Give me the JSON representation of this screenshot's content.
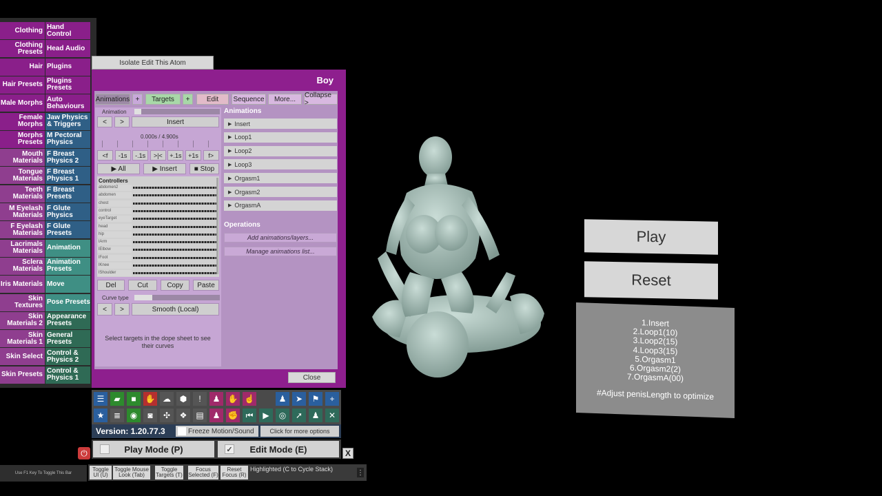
{
  "left_menu": {
    "rows": [
      {
        "left": "Clothing",
        "right": "Hand Control",
        "lc": "#8a1f8a",
        "rc": "#8a1f8a"
      },
      {
        "left": "Clothing Presets",
        "right": "Head Audio",
        "lc": "#8a1f8a",
        "rc": "#8a1f8a"
      },
      {
        "left": "Hair",
        "right": "Plugins",
        "lc": "#8a1f8a",
        "rc": "#8a1f8a"
      },
      {
        "left": "Hair Presets",
        "right": "Plugins Presets",
        "lc": "#8a1f8a",
        "rc": "#8a1f8a"
      },
      {
        "left": "Male Morphs",
        "right": "Auto Behaviours",
        "lc": "#8a1f8a",
        "rc": "#8a1f8a"
      },
      {
        "left": "Female Morphs",
        "right": "Jaw Physics & Triggers",
        "lc": "#8a1f8a",
        "rc": "#2f5f86"
      },
      {
        "left": "Morphs Presets",
        "right": "M Pectoral Physics",
        "lc": "#8a1f8a",
        "rc": "#2f5f86"
      },
      {
        "left": "Mouth Materials",
        "right": "F Breast Physics 2",
        "lc": "#8f3e8f",
        "rc": "#2f5f86"
      },
      {
        "left": "Tongue Materials",
        "right": "F Breast Physics 1",
        "lc": "#8f3e8f",
        "rc": "#2f5f86"
      },
      {
        "left": "Teeth Materials",
        "right": "F Breast Presets",
        "lc": "#8f3e8f",
        "rc": "#2f5f86"
      },
      {
        "left": "M Eyelash Materials",
        "right": "F Glute Physics",
        "lc": "#8f3e8f",
        "rc": "#2f5f86"
      },
      {
        "left": "F Eyelash Materials",
        "right": "F Glute Presets",
        "lc": "#8f3e8f",
        "rc": "#2f5f86"
      },
      {
        "left": "Lacrimals Materials",
        "right": "Animation",
        "lc": "#8f3e8f",
        "rc": "#3f8f84"
      },
      {
        "left": "Sclera Materials",
        "right": "Animation Presets",
        "lc": "#8f3e8f",
        "rc": "#3f8f84"
      },
      {
        "left": "Iris Materials",
        "right": "Move",
        "lc": "#8f3e8f",
        "rc": "#3f8f84"
      },
      {
        "left": "Skin Textures",
        "right": "Pose Presets",
        "lc": "#8f3e8f",
        "rc": "#3f8f84"
      },
      {
        "left": "Skin Materials 2",
        "right": "Appearance Presets",
        "lc": "#8f3e8f",
        "rc": "#2f6a55"
      },
      {
        "left": "Skin Materials 1",
        "right": "General Presets",
        "lc": "#8f3e8f",
        "rc": "#2f6a55"
      },
      {
        "left": "Skin Select",
        "right": "Control & Physics 2",
        "lc": "#8f3e8f",
        "rc": "#2f6a55"
      },
      {
        "left": "Skin Presets",
        "right": "Control & Physics 1",
        "lc": "#8f3e8f",
        "rc": "#2f6a55"
      }
    ]
  },
  "isolate_label": "Isolate Edit This Atom",
  "panel": {
    "title": "Boy",
    "tabs": [
      "Animations",
      "+",
      "Targets",
      "+",
      "Edit",
      "Sequence",
      "More...",
      "Collapse >"
    ],
    "animation_label": "Animation",
    "prev": "<",
    "next": ">",
    "insert": "Insert",
    "time": "0.000s / 4.900s",
    "step_buttons": [
      "<f",
      "-1s",
      "-.1s",
      ">|<",
      "+.1s",
      "+1s",
      "f>"
    ],
    "play_all": "▶ All",
    "play_insert": "▶ Insert",
    "stop": "■ Stop",
    "controllers_title": "Controllers",
    "controllers": [
      "abdomen2",
      "abdomen",
      "chest",
      "control",
      "eyeTarget",
      "head",
      "hip",
      "lArm",
      "lElbow",
      "lFoot",
      "lKnee",
      "lShoulder"
    ],
    "edit_buttons": [
      "Del",
      "Cut",
      "Copy",
      "Paste"
    ],
    "curve_type_label": "Curve type",
    "curve_value": "Smooth (Local)",
    "dope_hint": "Select targets in the dope sheet to see their curves",
    "animations_title": "Animations",
    "animations": [
      "Insert",
      "Loop1",
      "Loop2",
      "Loop3",
      "Orgasm1",
      "Orgasm2",
      "OrgasmA"
    ],
    "operations_title": "Operations",
    "op_add": "Add animations/layers...",
    "op_manage": "Manage animations list...",
    "close": "Close"
  },
  "toolbar": {
    "icons_row1": [
      {
        "name": "hamburger-icon",
        "glyph": "☰",
        "bg": "#2a5f9e"
      },
      {
        "name": "folder-open-icon",
        "glyph": "▰",
        "bg": "#2d8a2d"
      },
      {
        "name": "folder-icon",
        "glyph": "■",
        "bg": "#2d8a2d"
      },
      {
        "name": "hand-down-icon",
        "glyph": "✋",
        "bg": "#b52f2f"
      },
      {
        "name": "cloud-upload-icon",
        "glyph": "☁",
        "bg": "#555555"
      },
      {
        "name": "cube-icon",
        "glyph": "⬢",
        "bg": "#555555"
      },
      {
        "name": "alert-icon",
        "glyph": "!",
        "bg": "#555555"
      },
      {
        "name": "person-icon",
        "glyph": "♟",
        "bg": "#a02a6a"
      },
      {
        "name": "hand-icon",
        "glyph": "✋",
        "bg": "#a02a6a"
      },
      {
        "name": "pointer-hand-icon",
        "glyph": "☝",
        "bg": "#a02a6a"
      },
      {
        "name": "user-icon",
        "glyph": "♟",
        "bg": "#2a5f9e"
      },
      {
        "name": "send-icon",
        "glyph": "➤",
        "bg": "#2a5f9e"
      },
      {
        "name": "flag-icon",
        "glyph": "⚑",
        "bg": "#2a5f9e"
      },
      {
        "name": "plus-icon",
        "glyph": "+",
        "bg": "#2a5f9e"
      }
    ],
    "icons_row2": [
      {
        "name": "star-icon",
        "glyph": "★",
        "bg": "#2a5f9e"
      },
      {
        "name": "stack-icon",
        "glyph": "≣",
        "bg": "#555555"
      },
      {
        "name": "camera-green-icon",
        "glyph": "◉",
        "bg": "#2d8a2d"
      },
      {
        "name": "camera-icon",
        "glyph": "◙",
        "bg": "#555555"
      },
      {
        "name": "nodes-icon",
        "glyph": "✣",
        "bg": "#555555"
      },
      {
        "name": "dropbox-icon",
        "glyph": "❖",
        "bg": "#555555"
      },
      {
        "name": "document-icon",
        "glyph": "▤",
        "bg": "#555555"
      },
      {
        "name": "person-pink-icon",
        "glyph": "♟",
        "bg": "#a02a6a"
      },
      {
        "name": "hand-grab-icon",
        "glyph": "✊",
        "bg": "#a02a6a"
      },
      {
        "name": "skip-back-icon",
        "glyph": "⏮",
        "bg": "#2e6a5a"
      },
      {
        "name": "play-icon",
        "glyph": "▶",
        "bg": "#2e6a5a"
      },
      {
        "name": "target-icon",
        "glyph": "◎",
        "bg": "#2e6a5a"
      },
      {
        "name": "cursor-icon",
        "glyph": "➚",
        "bg": "#2e6a5a"
      },
      {
        "name": "users-icon",
        "glyph": "♟",
        "bg": "#2e6a5a"
      },
      {
        "name": "tools-icon",
        "glyph": "✕",
        "bg": "#2e6a5a"
      }
    ]
  },
  "version": "Version: 1.20.77.3",
  "freeze_label": "Freeze Motion/Sound",
  "options_label": "Click for more options",
  "play_mode": "Play Mode (P)",
  "edit_mode": "Edit Mode (E)",
  "edit_check": "✓",
  "x_label": "X",
  "power_glyph": "⏻",
  "f1_hint": "Use F1 Key To Toggle This Bar",
  "bottom_bar": {
    "buttons": [
      "Toggle UI (U)",
      "Toggle Mouse Look (Tab)",
      "Toggle Targets (T)",
      "Focus Selected (F)",
      "Reset Focus (R)"
    ],
    "highlighted": "Highlighted (C to Cycle Stack)",
    "dots": "⋮"
  },
  "right_panel": {
    "play": "Play",
    "reset": "Reset",
    "list": [
      "1.Insert",
      "2.Loop1(10)",
      "3.Loop2(15)",
      "4.Loop3(15)",
      "5.Orgasm1",
      "6.Orgasm2(2)",
      "7.OrgasmA(00)"
    ],
    "note": "#Adjust penisLength to optimize"
  }
}
